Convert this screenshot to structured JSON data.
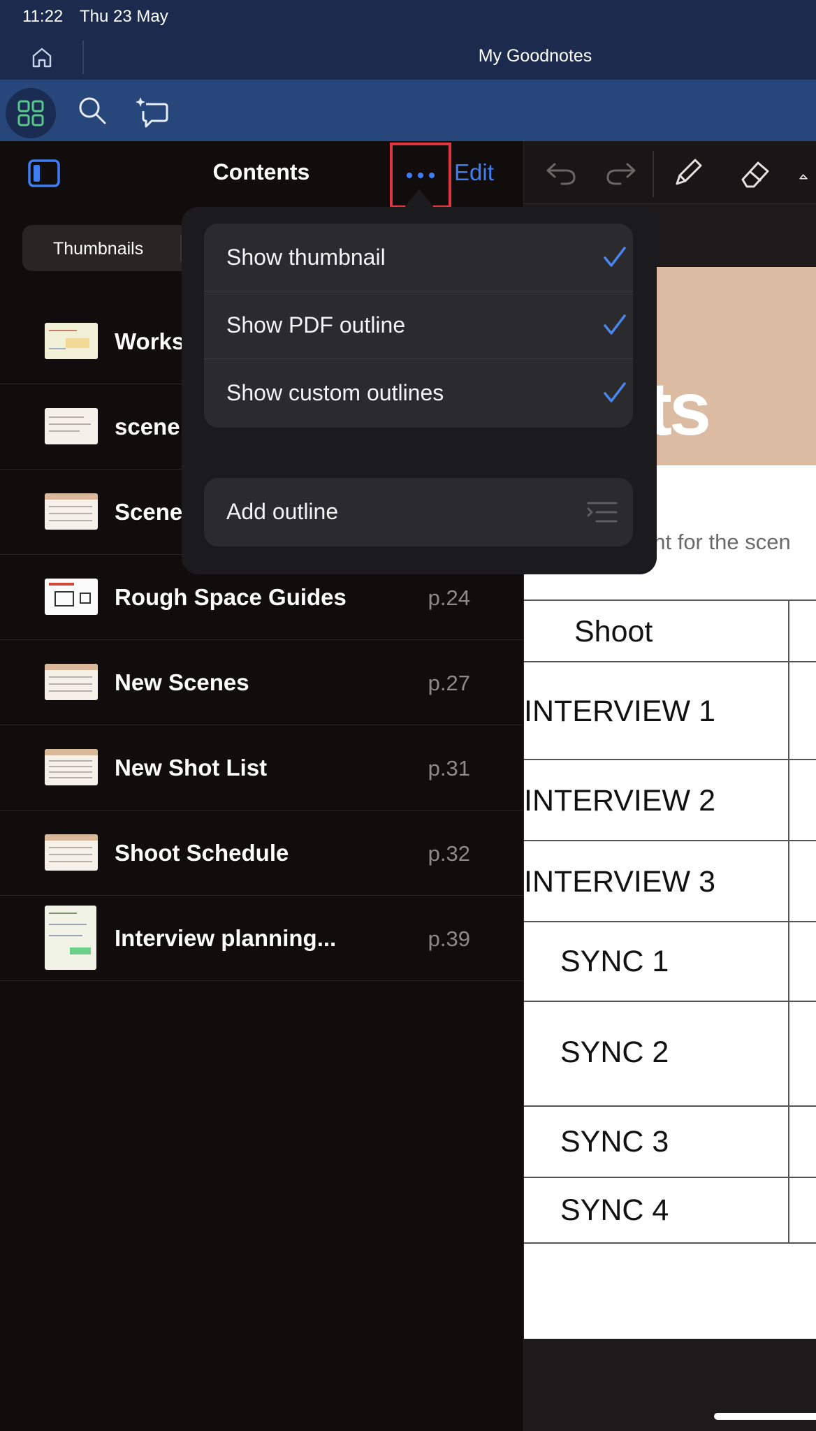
{
  "status": {
    "time": "11:22",
    "date": "Thu 23 May"
  },
  "window": {
    "title": "My Goodnotes"
  },
  "sidebar": {
    "title": "Contents",
    "edit_label": "Edit",
    "segment": {
      "thumbnails_label": "Thumbnails"
    },
    "items": [
      {
        "title": "Works",
        "page": ""
      },
      {
        "title": "scene",
        "page": ""
      },
      {
        "title": "Scene",
        "page": ""
      },
      {
        "title": "Rough Space Guides",
        "page": "p.24"
      },
      {
        "title": "New Scenes",
        "page": "p.27"
      },
      {
        "title": "New Shot List",
        "page": "p.31"
      },
      {
        "title": "Shoot Schedule",
        "page": "p.32"
      },
      {
        "title": "Interview planning...",
        "page": "p.39"
      }
    ]
  },
  "popover": {
    "options": [
      {
        "label": "Show thumbnail",
        "checked": true
      },
      {
        "label": "Show PDF outline",
        "checked": true
      },
      {
        "label": "Show custom outlines",
        "checked": true
      }
    ],
    "add_outline_label": "Add outline"
  },
  "document": {
    "banner_text": "ts",
    "subtitle": "ght for the scen",
    "table_header": "Shoot",
    "rows": [
      "INTERVIEW 1",
      "INTERVIEW 2",
      "INTERVIEW 3",
      "SYNC 1",
      "SYNC 2",
      "SYNC 3",
      "SYNC 4"
    ]
  },
  "colors": {
    "accent": "#3f7ef2",
    "highlight_box": "#e0363f",
    "toolbar": "#27467a",
    "titlebar": "#1c2a4e"
  }
}
